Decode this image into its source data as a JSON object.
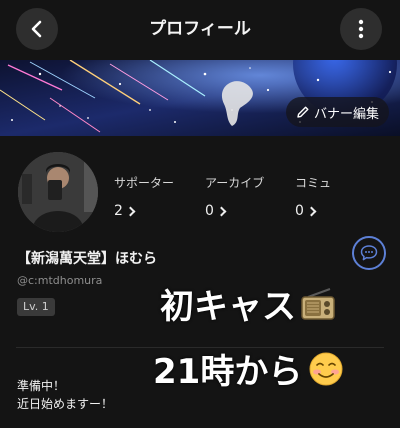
{
  "header": {
    "title": "プロフィール",
    "back_icon": "chevron-left-icon",
    "more_icon": "vertical-dots-icon"
  },
  "banner": {
    "edit_label": "バナー編集",
    "edit_icon": "pencil-icon"
  },
  "stats": [
    {
      "label": "サポーター",
      "value": "2"
    },
    {
      "label": "アーカイブ",
      "value": "0"
    },
    {
      "label": "コミュ",
      "value": "0"
    }
  ],
  "profile": {
    "name": "【新潟萬天堂】ほむら",
    "handle": "@c:mtdhomura",
    "level": "Lv. 1",
    "chat_icon": "chat-bubble-icon"
  },
  "overlay": {
    "line1": "初キャス",
    "line1_emoji": "📻",
    "line2": "21時から",
    "line2_emoji": "☺️"
  },
  "bio": {
    "line1": "準備中！",
    "line2": "近日始めますー！"
  },
  "colors": {
    "background": "#141414",
    "accent": "#5d80d6"
  }
}
